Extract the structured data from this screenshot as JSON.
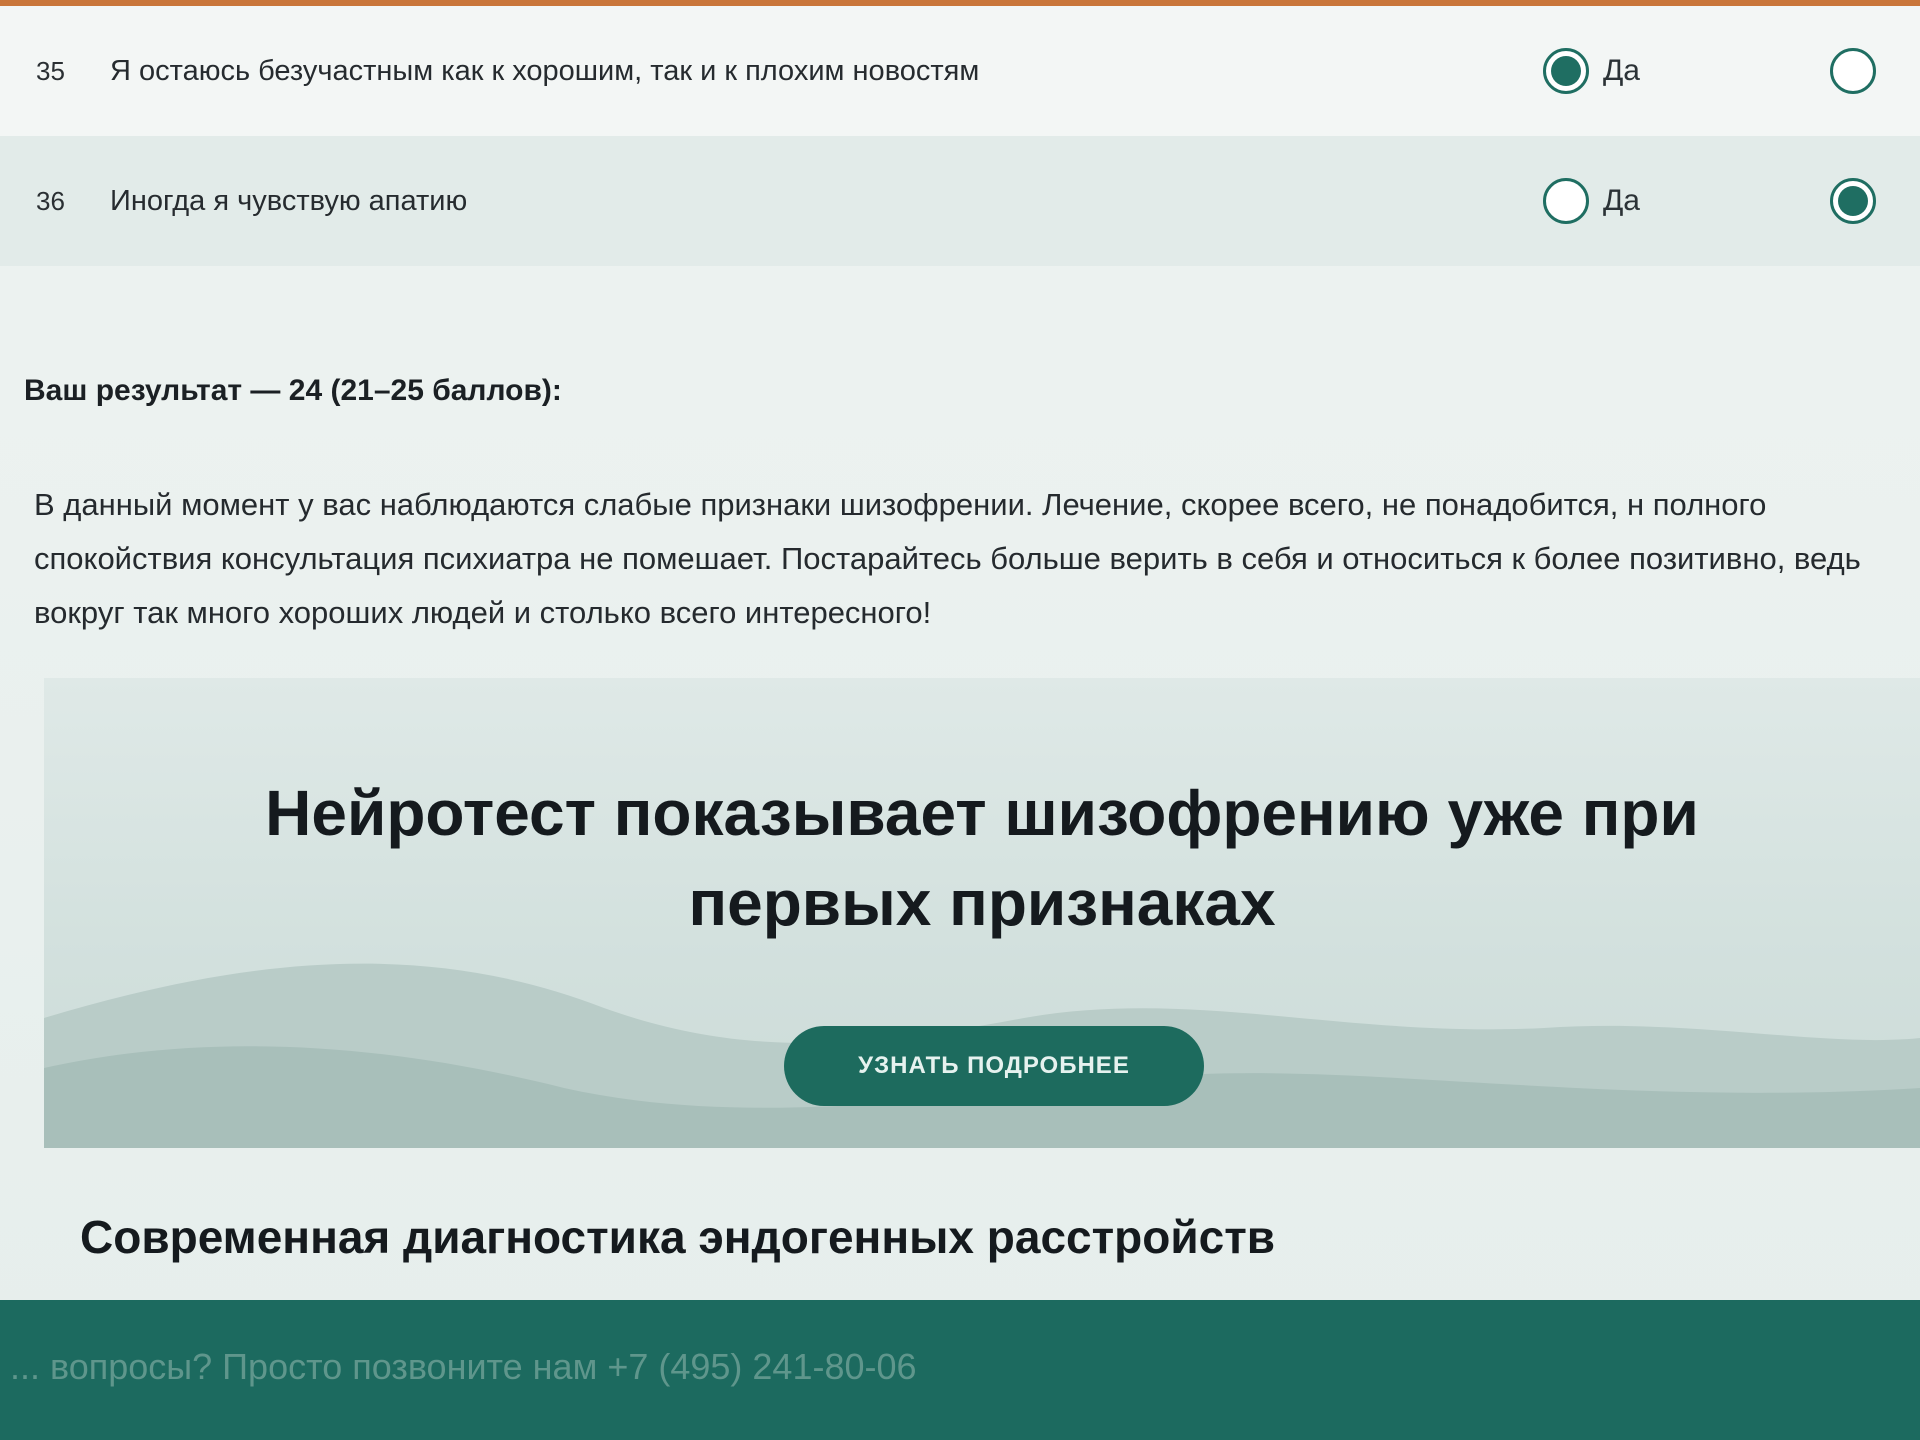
{
  "questions": [
    {
      "number": "35",
      "text": "Я остаюсь безучастным как к хорошим, так и к плохим новостям",
      "options": [
        {
          "label": "Да",
          "checked": true
        },
        {
          "label": "",
          "checked": false
        }
      ]
    },
    {
      "number": "36",
      "text": "Иногда я чувствую апатию",
      "options": [
        {
          "label": "Да",
          "checked": false
        },
        {
          "label": "",
          "checked": true
        }
      ]
    }
  ],
  "result": {
    "heading": "Ваш результат — 24 (21–25 баллов):",
    "text": "В данный момент у вас наблюдаются слабые признаки шизофрении. Лечение, скорее всего, не понадобится, н полного спокойствия консультация психиатра не помешает. Постарайтесь больше верить в себя и относиться к более позитивно, ведь вокруг так много хороших людей и столько всего интересного!"
  },
  "banner": {
    "title": "Нейротест показывает шизофрению уже при первых признаках",
    "button_label": "УЗНАТЬ ПОДРОБНЕЕ"
  },
  "section": {
    "heading": "Современная диагностика эндогенных расстройств"
  },
  "footer": {
    "text": "... вопросы? Просто позвоните нам +7 (495) 241-80-06"
  },
  "colors": {
    "accent": "#1d6b5e",
    "top_rule": "#c9763a"
  },
  "icons": {
    "radio": "radio-button-icon"
  }
}
